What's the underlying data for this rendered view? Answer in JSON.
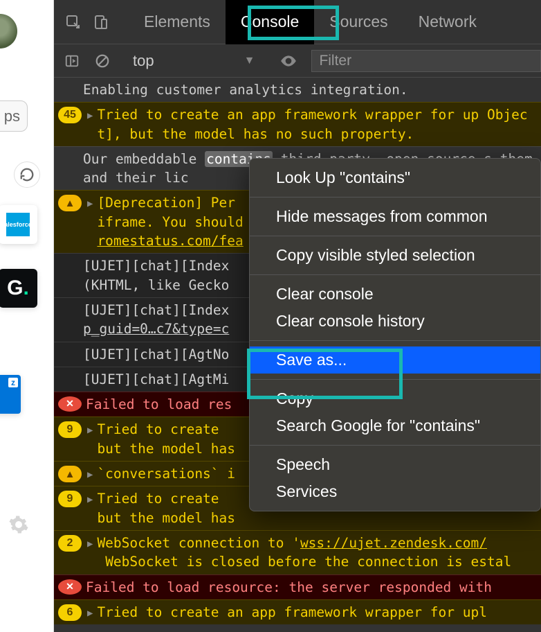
{
  "left": {
    "ps_label": "ps",
    "sf_label": "alesforce",
    "g_letter": "G",
    "blue_corner": "z"
  },
  "devtools": {
    "tabs": {
      "elements": "Elements",
      "console": "Console",
      "sources": "Sources",
      "network": "Network"
    },
    "toolbar": {
      "context": "top",
      "filter_placeholder": "Filter"
    }
  },
  "console": {
    "m0": "Enabling customer analytics integration.",
    "m1_count": "45",
    "m1": "Tried to create an app framework wrapper for up Object], but the model has no such property.",
    "m2_pre": "Our embeddable ",
    "m2_hl": "contains",
    "m2_post": " third-party, open source s them and their lic",
    "m3": "[Deprecation] Per iframe. You should romestatus.com/fea",
    "m4": "[UJET][chat][Index (KHTML, like Gecko",
    "m5": "[UJET][chat][Index p_guid=0…c7&type=c",
    "m6": "[UJET][chat][AgtNo",
    "m7": "[UJET][chat][AgtMi",
    "m8": "Failed to load res",
    "m9_count": "9",
    "m9": "Tried to create but the model has",
    "m10": "`conversations` i",
    "m11_count": "9",
    "m11": "Tried to create but the model has",
    "m12_count": "2",
    "m12_pre": "WebSocket connection to '",
    "m12_link": "wss://ujet.zendesk.com/",
    "m12_post": " WebSocket is closed before the connection is estal",
    "m13": "Failed to load resource: the server responded with",
    "m14_count": "6",
    "m14": "Tried to create an app framework wrapper for upl"
  },
  "menu": {
    "lookup": "Look Up \"contains\"",
    "hide": "Hide messages from common",
    "copyvis": "Copy visible styled selection",
    "clear": "Clear console",
    "clearhist": "Clear console history",
    "saveas": "Save as...",
    "copy": "Copy",
    "search": "Search Google for \"contains\"",
    "speech": "Speech",
    "services": "Services"
  }
}
